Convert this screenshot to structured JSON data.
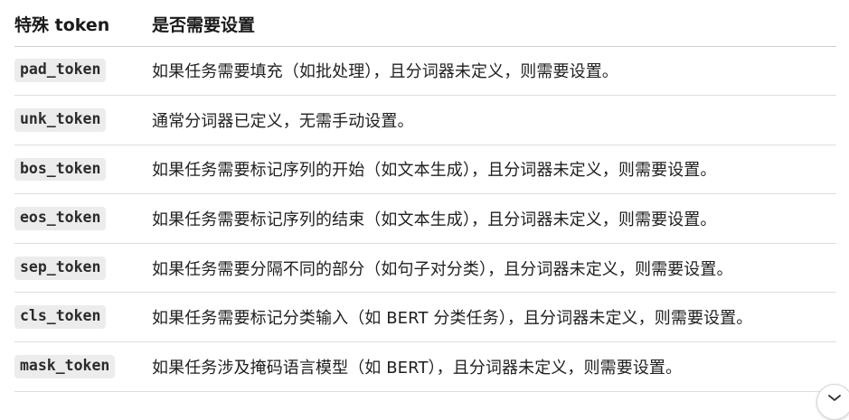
{
  "table": {
    "headers": [
      "特殊 token",
      "是否需要设置"
    ],
    "rows": [
      {
        "token": "pad_token",
        "desc": "如果任务需要填充（如批处理），且分词器未定义，则需要设置。"
      },
      {
        "token": "unk_token",
        "desc": "通常分词器已定义，无需手动设置。"
      },
      {
        "token": "bos_token",
        "desc": "如果任务需要标记序列的开始（如文本生成），且分词器未定义，则需要设置。"
      },
      {
        "token": "eos_token",
        "desc": "如果任务需要标记序列的结束（如文本生成），且分词器未定义，则需要设置。"
      },
      {
        "token": "sep_token",
        "desc": "如果任务需要分隔不同的部分（如句子对分类），且分词器未定义，则需要设置。"
      },
      {
        "token": "cls_token",
        "desc": "如果任务需要标记分类输入（如 BERT 分类任务），且分词器未定义，则需要设置。"
      },
      {
        "token": "mask_token",
        "desc": "如果任务涉及掩码语言模型（如 BERT），且分词器未定义，则需要设置。"
      }
    ]
  },
  "icons": {
    "scroll_button": "chevron-down-icon"
  }
}
